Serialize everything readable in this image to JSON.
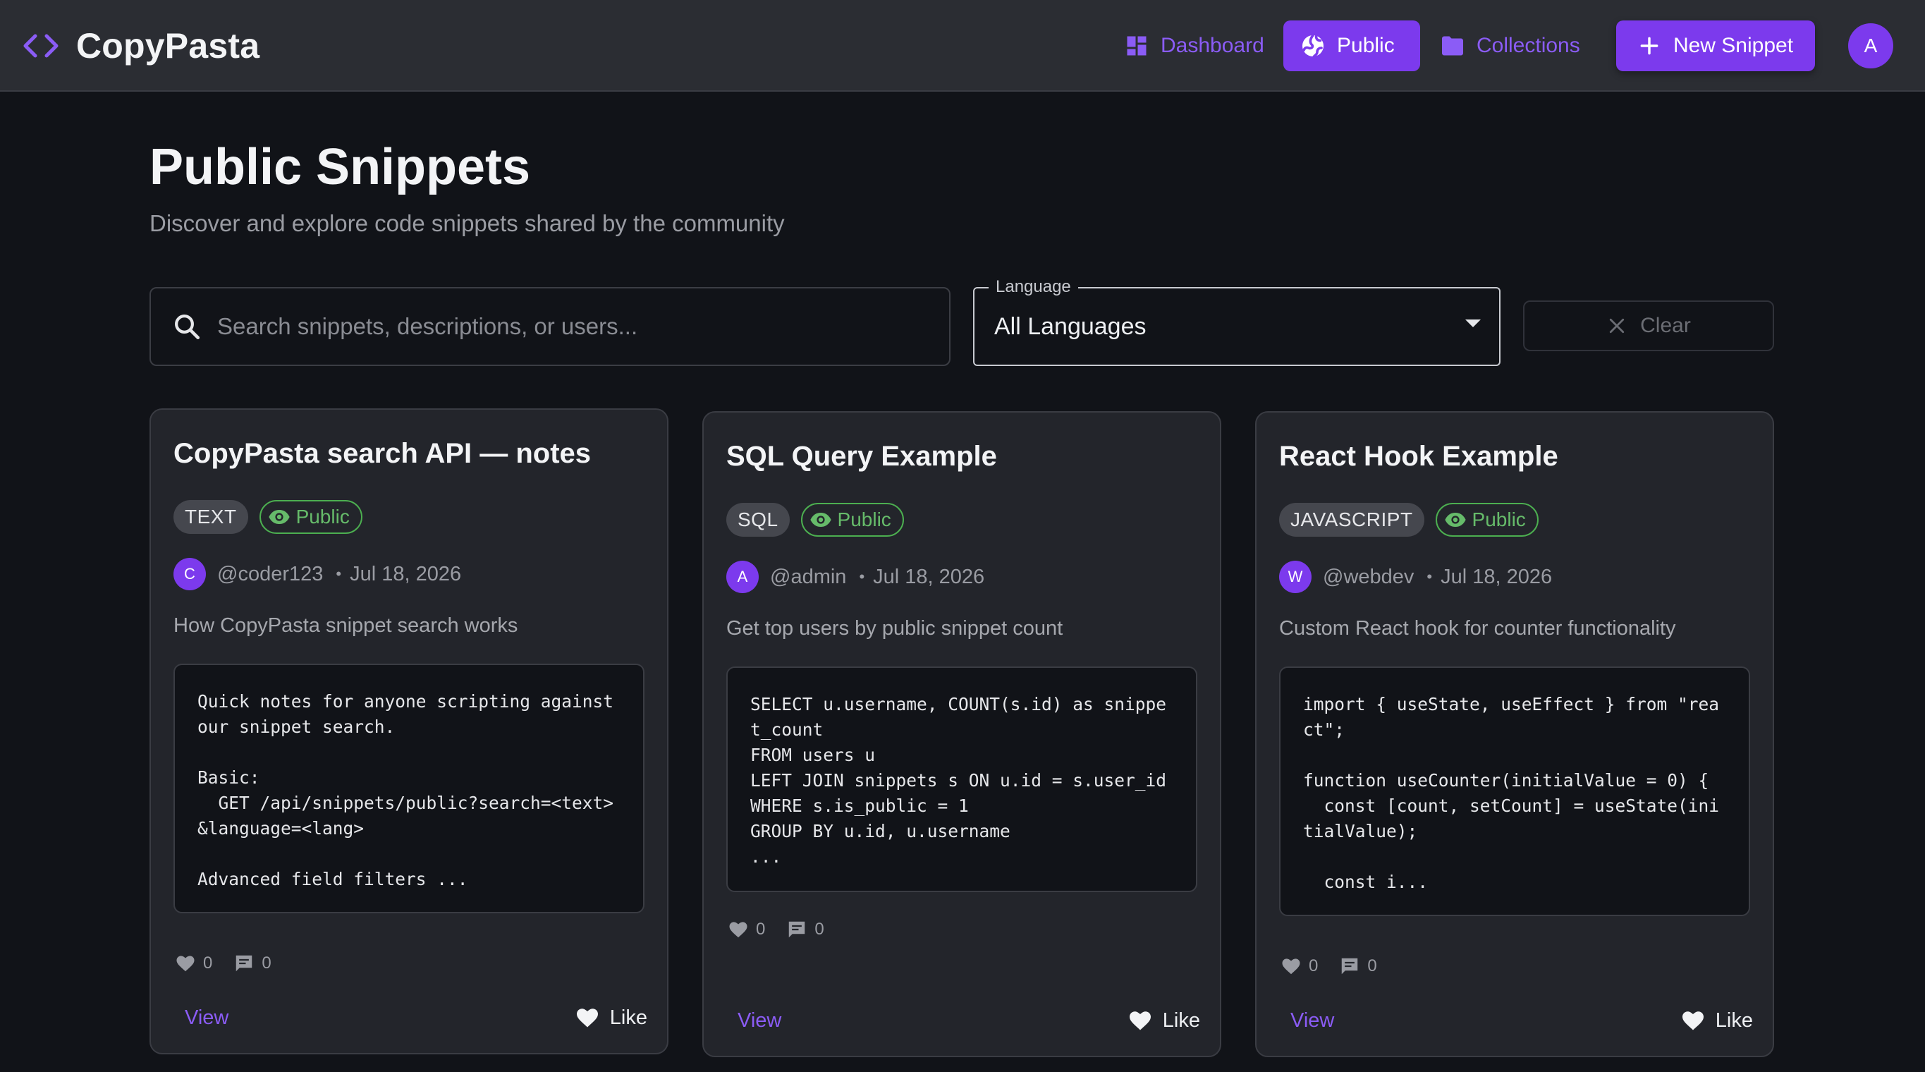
{
  "app": {
    "name": "CopyPasta",
    "accent": "#7c3aed",
    "brand_icon": "code-brackets-icon"
  },
  "nav": {
    "dashboard": {
      "label": "Dashboard",
      "icon": "dashboard-icon"
    },
    "public": {
      "label": "Public",
      "icon": "globe-icon",
      "active": true
    },
    "collections": {
      "label": "Collections",
      "icon": "folder-icon"
    },
    "new_snippet": {
      "label": "New Snippet",
      "icon": "plus-icon"
    },
    "user_initial": "A"
  },
  "header": {
    "title": "Public Snippets",
    "subtitle": "Discover and explore code snippets shared by the community"
  },
  "filters": {
    "search_placeholder": "Search snippets, descriptions, or users...",
    "search_value": "",
    "language_label": "Language",
    "language_value": "All Languages",
    "clear_label": "Clear"
  },
  "cards": [
    {
      "title": "CopyPasta search API — notes",
      "language": "TEXT",
      "visibility": "Public",
      "author_initial": "C",
      "author": "@coder123",
      "date": "Jul 18, 2026",
      "description": "How CopyPasta snippet search works",
      "code": "Quick notes for anyone scripting against our snippet search.\n\nBasic:\n  GET /api/snippets/public?search=<text>&language=<lang>\n\nAdvanced field filters ...",
      "likes": "0",
      "comments": "0",
      "view_label": "View",
      "like_label": "Like"
    },
    {
      "title": "SQL Query Example",
      "language": "SQL",
      "visibility": "Public",
      "author_initial": "A",
      "author": "@admin",
      "date": "Jul 18, 2026",
      "description": "Get top users by public snippet count",
      "code": "SELECT u.username, COUNT(s.id) as snippet_count\nFROM users u\nLEFT JOIN snippets s ON u.id = s.user_id\nWHERE s.is_public = 1\nGROUP BY u.id, u.username\n...",
      "likes": "0",
      "comments": "0",
      "view_label": "View",
      "like_label": "Like"
    },
    {
      "title": "React Hook Example",
      "language": "JAVASCRIPT",
      "visibility": "Public",
      "author_initial": "W",
      "author": "@webdev",
      "date": "Jul 18, 2026",
      "description": "Custom React hook for counter functionality",
      "code": "import { useState, useEffect } from \"react\";\n\nfunction useCounter(initialValue = 0) {\n  const [count, setCount] = useState(initialValue);\n\n  const i...",
      "likes": "0",
      "comments": "0",
      "view_label": "View",
      "like_label": "Like"
    }
  ]
}
